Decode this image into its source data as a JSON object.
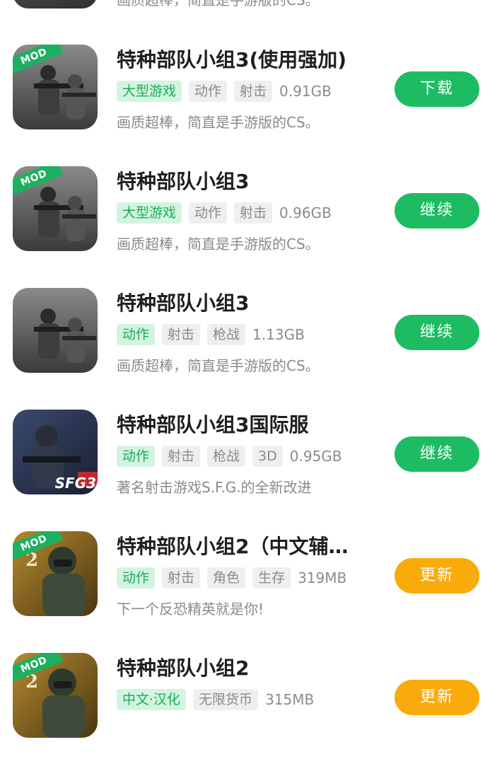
{
  "top_partial": {
    "desc": "画质超棒，简直是手游版的CS。"
  },
  "badges": {
    "mod": "MOD",
    "sfg": "SFG3",
    "digit_2": "2"
  },
  "apps": [
    {
      "title": "特种部队小组3(使用强加)",
      "mod": true,
      "icon": "soldiers-icon",
      "tags": [
        {
          "label": "大型游戏",
          "highlight": true
        },
        {
          "label": "动作",
          "highlight": false
        },
        {
          "label": "射击",
          "highlight": false
        }
      ],
      "size": "0.91GB",
      "desc": "画质超棒，简直是手游版的CS。",
      "button": {
        "label": "下载",
        "color": "#1dbc63"
      }
    },
    {
      "title": "特种部队小组3",
      "mod": true,
      "icon": "soldiers-icon",
      "tags": [
        {
          "label": "大型游戏",
          "highlight": true
        },
        {
          "label": "动作",
          "highlight": false
        },
        {
          "label": "射击",
          "highlight": false
        }
      ],
      "size": "0.96GB",
      "desc": "画质超棒，简直是手游版的CS。",
      "button": {
        "label": "继续",
        "color": "#1dbc63"
      }
    },
    {
      "title": "特种部队小组3",
      "mod": false,
      "icon": "soldiers-icon",
      "tags": [
        {
          "label": "动作",
          "highlight": true
        },
        {
          "label": "射击",
          "highlight": false
        },
        {
          "label": "枪战",
          "highlight": false
        }
      ],
      "size": "1.13GB",
      "desc": "画质超棒，简直是手游版的CS。",
      "button": {
        "label": "继续",
        "color": "#1dbc63"
      }
    },
    {
      "title": "特种部队小组3国际服",
      "mod": false,
      "icon": "sfg3-soldier-icon",
      "tags": [
        {
          "label": "动作",
          "highlight": true
        },
        {
          "label": "射击",
          "highlight": false
        },
        {
          "label": "枪战",
          "highlight": false
        },
        {
          "label": "3D",
          "highlight": false
        }
      ],
      "size": "0.95GB",
      "desc": "著名射击游戏S.F.G.的全新改进",
      "button": {
        "label": "继续",
        "color": "#1dbc63"
      }
    },
    {
      "title": "特种部队小组2（中文辅…",
      "mod": true,
      "icon": "masked-soldier-icon",
      "tags": [
        {
          "label": "动作",
          "highlight": true
        },
        {
          "label": "射击",
          "highlight": false
        },
        {
          "label": "角色",
          "highlight": false
        },
        {
          "label": "生存",
          "highlight": false
        }
      ],
      "size": "319MB",
      "desc": "下一个反恐精英就是你!",
      "button": {
        "label": "更新",
        "color": "#f9ab0c"
      }
    },
    {
      "title": "特种部队小组2",
      "mod": true,
      "icon": "masked-soldier-icon",
      "tags": [
        {
          "label": "中文·汉化",
          "highlight": true
        },
        {
          "label": "无限货币",
          "highlight": false
        }
      ],
      "size": "315MB",
      "desc": "",
      "button": {
        "label": "更新",
        "color": "#f9ab0c"
      }
    }
  ]
}
